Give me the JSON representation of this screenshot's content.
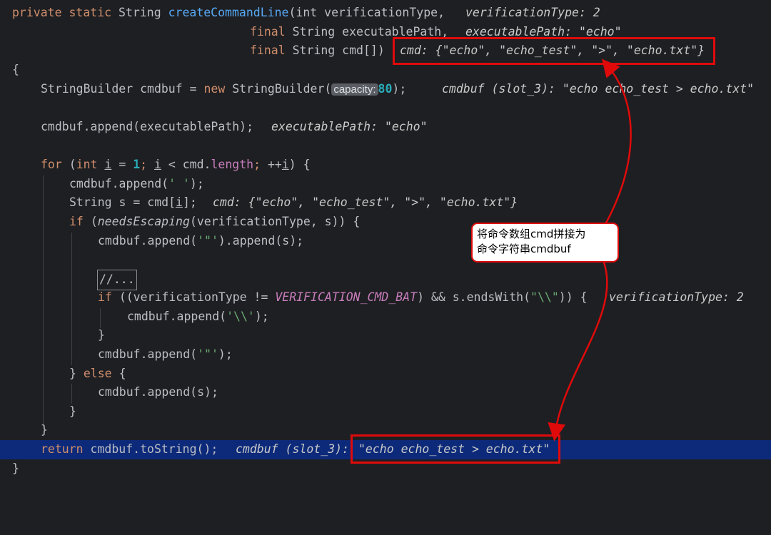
{
  "code": {
    "l1_private": "private",
    "l1_static": "static",
    "l1_type": "String",
    "l1_fn": "createCommandLine",
    "l1_params": "(int verificationType,",
    "l1_hint": "verificationType: 2",
    "l2_final": "final",
    "l2_rest": "String executablePath,",
    "l2_hint": "executablePath: \"echo\"",
    "l3_final": "final",
    "l3_rest": "String cmd[])",
    "l3_hint": "cmd: {\"echo\", \"echo_test\", \">\", \"echo.txt\"}",
    "l4_brace": "{",
    "l5_a": "StringBuilder cmdbuf =",
    "l5_new": "new",
    "l5_b": "StringBuilder(",
    "l5_inlay": "capacity:",
    "l5_num": "80",
    "l5_c": ");",
    "l5_hint": "cmdbuf (slot_3): \"echo echo_test > echo.txt\"",
    "l7_a": "cmdbuf.append(executablePath);",
    "l7_hint": "executablePath: \"echo\"",
    "l9_for": "for",
    "l9_a": "(",
    "l9_int": "int",
    "l9_i1": "i",
    "l9_b": "=",
    "l9_one": "1",
    "l9_semi1": ";",
    "l9_i2": "i",
    "l9_c": "< cmd.",
    "l9_len": "length",
    "l9_semi2": ";",
    "l9_d": "++",
    "l9_i3": "i",
    "l9_e": ") {",
    "l10_a": "cmdbuf.append(",
    "l10_str": "' '",
    "l10_b": ");",
    "l11_a": "String s = cmd[",
    "l11_i": "i",
    "l11_b": "];",
    "l11_hint": "cmd: {\"echo\", \"echo_test\", \">\", \"echo.txt\"}",
    "l12_if": "if",
    "l12_a": "(",
    "l12_fn": "needsEscaping",
    "l12_b": "(verificationType, s)) {",
    "l13_a": "cmdbuf.append(",
    "l13_str": "'\"'",
    "l13_b": ").append(s);",
    "l15_fold": "//...",
    "l16_if": "if",
    "l16_a": "((verificationType !=",
    "l16_const": "VERIFICATION_CMD_BAT",
    "l16_b": ") && s.endsWith(",
    "l16_str": "\"\\\\\"",
    "l16_c": ")) {",
    "l16_hint": "verificationType: 2",
    "l17_a": "cmdbuf.append(",
    "l17_str": "'\\\\'",
    "l17_b": ");",
    "l18_brace": "}",
    "l19_a": "cmdbuf.append(",
    "l19_str": "'\"'",
    "l19_b": ");",
    "l20_a": "}",
    "l20_else": "else",
    "l20_b": "{",
    "l21_a": "cmdbuf.append(s);",
    "l22_brace": "}",
    "l23_brace": "}",
    "l24_return": "return",
    "l24_a": "cmdbuf.toString();",
    "l24_hint_a": "cmdbuf (slot_3):",
    "l24_hint_b": "\"echo echo_test > echo.txt\"",
    "l25_brace": "}"
  },
  "annotation": {
    "line1": "将命令数组cmd拼接为",
    "line2": "命令字符串cmdbuf"
  },
  "colors": {
    "background": "#1e1f22",
    "execution_line": "#0d2a7a",
    "keyword": "#cf8e6d",
    "number": "#2aacb8",
    "string": "#6aab73",
    "method": "#56a8f5",
    "field": "#c77dbb",
    "highlight_box": "#e00a0a"
  }
}
